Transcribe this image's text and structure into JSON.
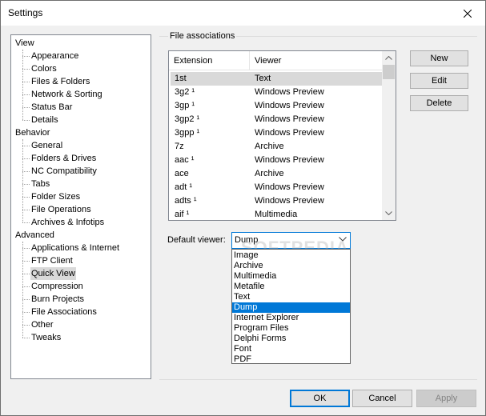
{
  "window": {
    "title": "Settings"
  },
  "tree": {
    "groups": [
      {
        "label": "View",
        "children": [
          "Appearance",
          "Colors",
          "Files & Folders",
          "Network & Sorting",
          "Status Bar",
          "Details"
        ]
      },
      {
        "label": "Behavior",
        "children": [
          "General",
          "Folders & Drives",
          "NC Compatibility",
          "Tabs",
          "Folder Sizes",
          "File Operations",
          "Archives & Infotips"
        ]
      },
      {
        "label": "Advanced",
        "children": [
          "Applications & Internet",
          "FTP Client",
          "Quick View",
          "Compression",
          "Burn Projects",
          "File Associations",
          "Other",
          "Tweaks"
        ]
      }
    ],
    "selected": "Quick View"
  },
  "file_associations": {
    "group_label": "File associations",
    "columns": [
      "Extension",
      "Viewer"
    ],
    "rows": [
      [
        "1st",
        "Text"
      ],
      [
        "3g2 ¹",
        "Windows Preview"
      ],
      [
        "3gp ¹",
        "Windows Preview"
      ],
      [
        "3gp2 ¹",
        "Windows Preview"
      ],
      [
        "3gpp ¹",
        "Windows Preview"
      ],
      [
        "7z",
        "Archive"
      ],
      [
        "aac ¹",
        "Windows Preview"
      ],
      [
        "ace",
        "Archive"
      ],
      [
        "adt ¹",
        "Windows Preview"
      ],
      [
        "adts ¹",
        "Windows Preview"
      ],
      [
        "aif ¹",
        "Multimedia"
      ]
    ],
    "selected_row": 0
  },
  "side_buttons": {
    "new": "New",
    "edit": "Edit",
    "delete": "Delete"
  },
  "default_viewer": {
    "label": "Default viewer:",
    "value": "Dump",
    "options": [
      "Image",
      "Archive",
      "Multimedia",
      "Metafile",
      "Text",
      "Dump",
      "Internet Explorer",
      "Program Files",
      "Delphi Forms",
      "Font",
      "PDF"
    ]
  },
  "watermark": "SOFTPEDIA",
  "footer": {
    "ok": "OK",
    "cancel": "Cancel",
    "apply": "Apply"
  },
  "colors": {
    "accent": "#0078d7",
    "selection": "#d9d9d9"
  }
}
